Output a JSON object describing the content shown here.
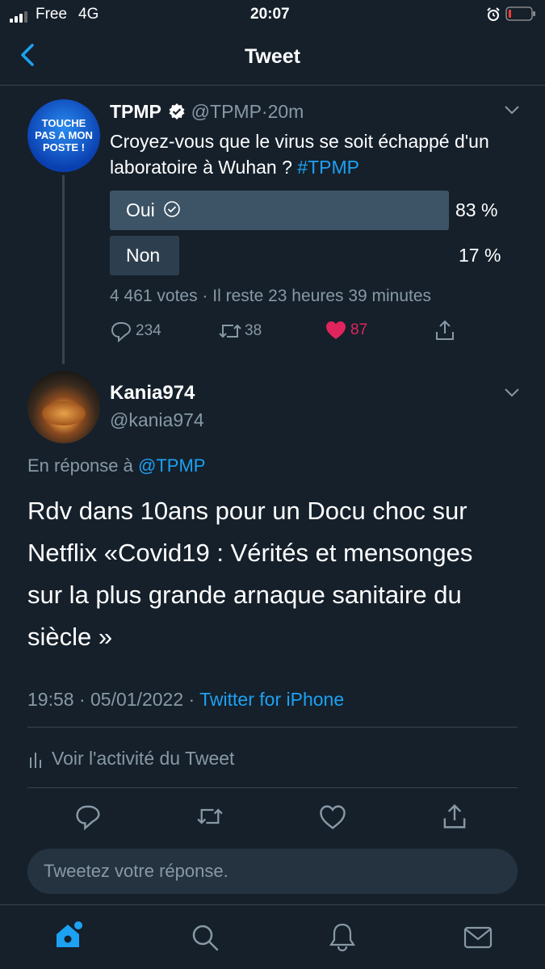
{
  "status_bar": {
    "carrier": "Free",
    "network": "4G",
    "time": "20:07"
  },
  "nav": {
    "title": "Tweet",
    "back_icon": "chevron-left-icon"
  },
  "parent_tweet": {
    "avatar_text": "TOUCHE PAS A MON POSTE !",
    "display_name": "TPMP",
    "verified": true,
    "handle": "@TPMP",
    "separator": "·",
    "time": "20m",
    "text": "Croyez-vous que le virus se soit échappé d'un laboratoire à Wuhan ?",
    "hashtag": "#TPMP",
    "poll": {
      "options": [
        {
          "label": "Oui",
          "percent_label": "83 %",
          "percent": 83,
          "selected": true
        },
        {
          "label": "Non",
          "percent_label": "17 %",
          "percent": 17,
          "selected": false
        }
      ],
      "footer": "4 461 votes · Il reste 23 heures 39 minutes"
    },
    "actions": {
      "replies": "234",
      "retweets": "38",
      "likes": "87",
      "like_color": "#e0245e"
    }
  },
  "reply_tweet": {
    "display_name": "Kania974",
    "handle": "@kania974",
    "reply_prefix": "En réponse à",
    "reply_to": "@TPMP",
    "text": "Rdv dans 10ans pour un Docu choc sur Netflix «Covid19 : Vérités et mensonges sur la plus grande arnaque sanitaire du siècle »",
    "timestamp": "19:58 · 05/01/2022 ·",
    "source": "Twitter for iPhone",
    "activity_label": "Voir l'activité du Tweet"
  },
  "reply_box": {
    "placeholder": "Tweetez votre réponse."
  },
  "colors": {
    "background": "#15202b",
    "accent": "#1da1f2",
    "muted": "#8899a6",
    "like": "#e0245e"
  }
}
